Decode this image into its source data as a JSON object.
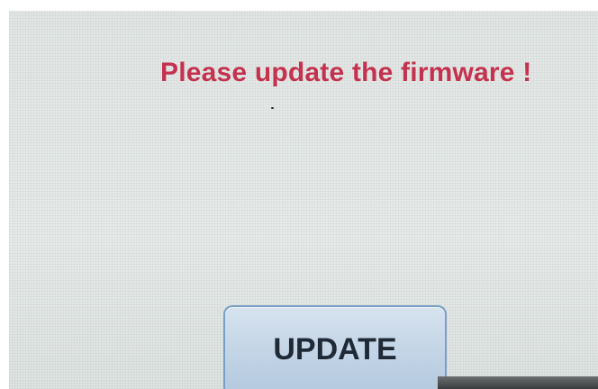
{
  "screen": {
    "message": "Please update the firmware !",
    "message_color": "#c4324f",
    "background_color": "#e4e9e7"
  },
  "update_button": {
    "label": "UPDATE",
    "fill_color": "#c5d6e7",
    "border_color": "#7a9fc6"
  }
}
